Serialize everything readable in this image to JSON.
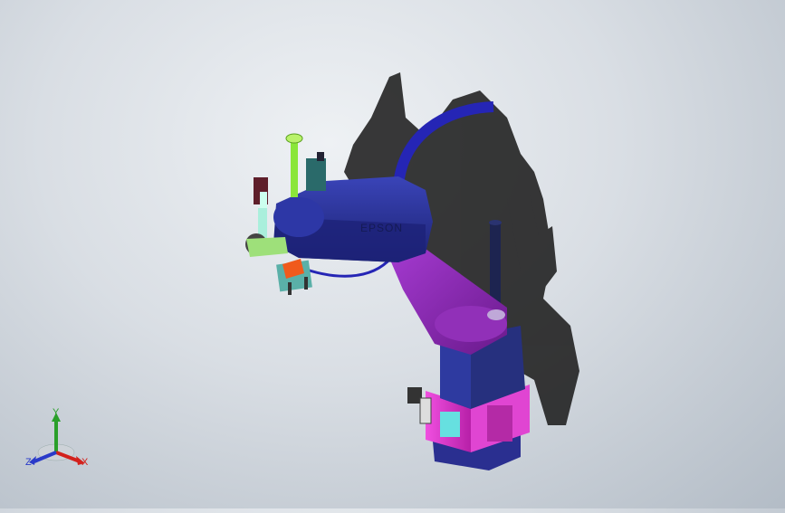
{
  "viewport": {
    "name": "3d-model-viewport",
    "brand_label": "EPSON",
    "colors": {
      "robot_arm": "#2a3196",
      "lower_arm": "#8a27b0",
      "base_block": "#e33bd2",
      "shaft": "#90ee40",
      "cable": "#2222aa",
      "shadow": "#1f1f1f"
    }
  },
  "triad": {
    "x_label": "X",
    "y_label": "Y",
    "z_label": "Z",
    "x_color": "#d3211c",
    "y_color": "#2a9f2a",
    "z_color": "#2a3ac9"
  }
}
